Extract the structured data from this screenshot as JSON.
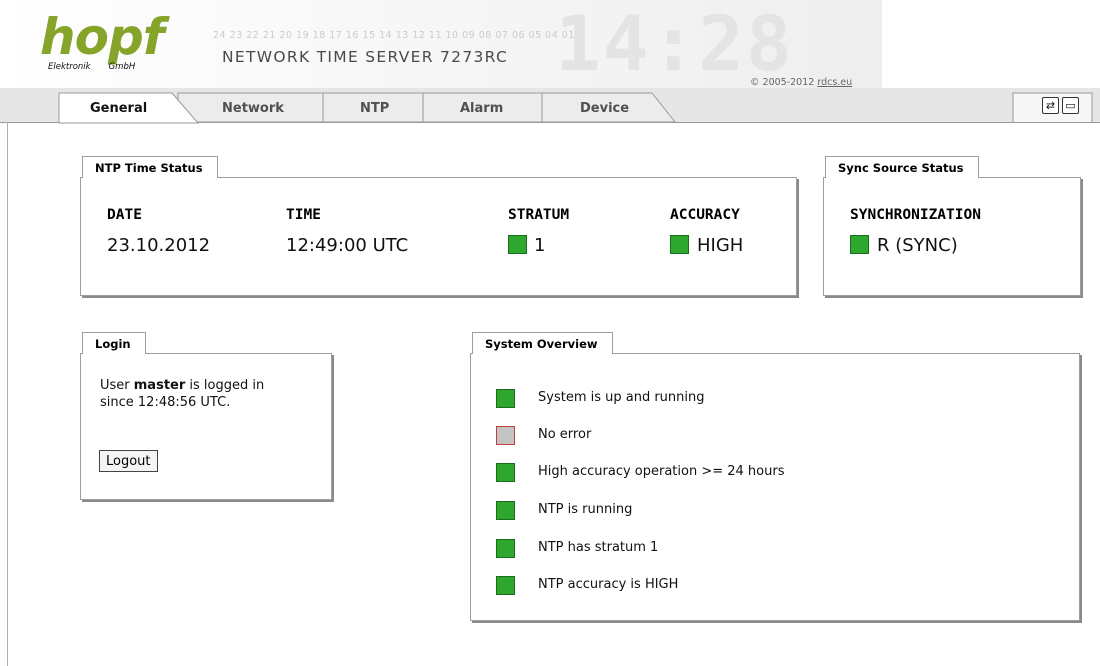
{
  "header": {
    "logo_text": "hopf",
    "logo_sub_left": "Elektronik",
    "logo_sub_right": "GmbH",
    "digit_strip": "24 23 22 21 20 19 18 17 16 15 14 13 12 11 10 09 08 07 06 05 04 01",
    "title": "NETWORK TIME SERVER 7273RC",
    "copyright_prefix": "© 2005-2012 ",
    "copyright_link": "rdcs.eu",
    "background_clock": "14:28"
  },
  "tabs": [
    {
      "label": "General",
      "active": true
    },
    {
      "label": "Network",
      "active": false
    },
    {
      "label": "NTP",
      "active": false
    },
    {
      "label": "Alarm",
      "active": false
    },
    {
      "label": "Device",
      "active": false
    }
  ],
  "toolbar": {
    "refresh_icon": "refresh-icon",
    "window_icon": "window-icon",
    "refresh_glyph": "⇄",
    "window_glyph": "▭"
  },
  "ntp_status": {
    "title": "NTP Time Status",
    "date_label": "DATE",
    "date_value": "23.10.2012",
    "time_label": "TIME",
    "time_value": "12:49:00 UTC",
    "stratum_label": "STRATUM",
    "stratum_value": "1",
    "stratum_led": "green",
    "accuracy_label": "ACCURACY",
    "accuracy_value": "HIGH",
    "accuracy_led": "green"
  },
  "sync_status": {
    "title": "Sync Source Status",
    "label": "SYNCHRONIZATION",
    "value": "R (SYNC)",
    "led": "green"
  },
  "login": {
    "title": "Login",
    "text_prefix": "User ",
    "user": "master",
    "text_suffix": " is logged in",
    "since_line": "since 12:48:56 UTC.",
    "logout_label": "Logout"
  },
  "system_overview": {
    "title": "System Overview",
    "items": [
      {
        "text": "System is up and running",
        "state": "green"
      },
      {
        "text": "No error",
        "state": "grey"
      },
      {
        "text": "High accuracy operation >= 24 hours",
        "state": "green"
      },
      {
        "text": "NTP is running",
        "state": "green"
      },
      {
        "text": "NTP has stratum 1",
        "state": "green"
      },
      {
        "text": "NTP accuracy is HIGH",
        "state": "green"
      }
    ]
  },
  "colors": {
    "led_green": "#2ea72e",
    "led_grey": "#c3c3c3",
    "logo_green": "#86a32a"
  }
}
